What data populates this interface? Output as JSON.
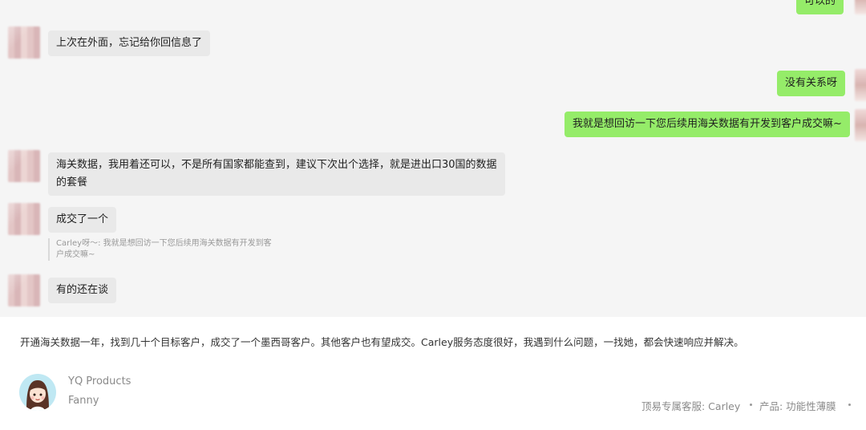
{
  "chat": {
    "messages": [
      {
        "sender": "me",
        "text": "可以的"
      },
      {
        "sender": "other",
        "text": "上次在外面，忘记给你回信息了"
      },
      {
        "sender": "me",
        "text": "没有关系呀"
      },
      {
        "sender": "me",
        "text": "我就是想回访一下您后续用海关数据有开发到客户成交嘛~"
      },
      {
        "sender": "other",
        "text": "海关数据，我用着还可以，不是所有国家都能查到，建议下次出个选择，就是进出口30国的数据的套餐"
      },
      {
        "sender": "other",
        "text": "成交了一个"
      },
      {
        "sender": "other",
        "text": "有的还在谈"
      }
    ],
    "quote": {
      "text": "Carley呀～: 我就是想回访一下您后续用海关数据有开发到客户成交嘛~"
    }
  },
  "review": {
    "text": "开通海关数据一年，找到几十个目标客户，成交了一个墨西哥客户。其他客户也有望成交。Carley服务态度很好，我遇到什么问题，一找她，都会快速响应并解决。"
  },
  "author": {
    "org": "YQ Products",
    "name": "Fanny",
    "avatar_icon": "cartoon-girl-avatar"
  },
  "meta": {
    "service": "顶易专属客服: Carley",
    "product": "产品: 功能性薄膜"
  }
}
